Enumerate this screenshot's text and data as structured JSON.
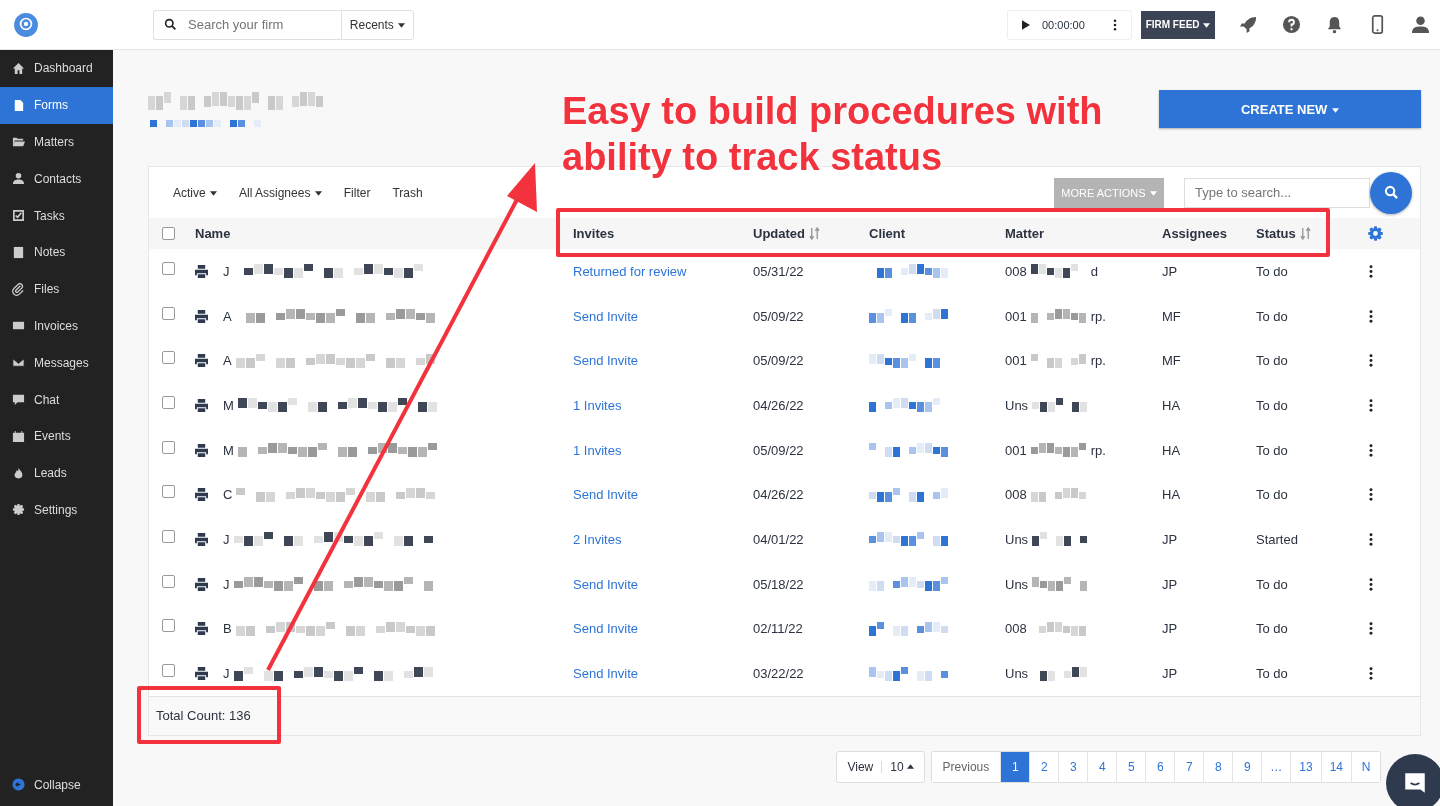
{
  "topbar": {
    "search": {
      "placeholder": "Search your firm"
    },
    "recents": "Recents",
    "timer": "00:00:00",
    "firm_feed": "FIRM FEED"
  },
  "sidebar": {
    "items": [
      {
        "label": "Dashboard",
        "selected": false
      },
      {
        "label": "Forms",
        "selected": true
      },
      {
        "label": "Matters",
        "selected": false
      },
      {
        "label": "Contacts",
        "selected": false
      },
      {
        "label": "Tasks",
        "selected": false
      },
      {
        "label": "Notes",
        "selected": false
      },
      {
        "label": "Files",
        "selected": false
      },
      {
        "label": "Invoices",
        "selected": false
      },
      {
        "label": "Messages",
        "selected": false
      },
      {
        "label": "Chat",
        "selected": false
      },
      {
        "label": "Events",
        "selected": false
      },
      {
        "label": "Leads",
        "selected": false
      },
      {
        "label": "Settings",
        "selected": false
      }
    ],
    "collapse": "Collapse"
  },
  "page": {
    "create_button": "CREATE NEW"
  },
  "toolbar": {
    "filters": [
      "Active",
      "All Assignees"
    ],
    "links": [
      "Filter",
      "Trash"
    ],
    "more_actions": "MORE ACTIONS",
    "search": {
      "placeholder": "Type to search..."
    }
  },
  "table": {
    "select_all": {
      "checked": false
    },
    "columns": [
      {
        "label": "Name",
        "sortable": false
      },
      {
        "label": "Invites",
        "sortable": false
      },
      {
        "label": "Updated",
        "sortable": true
      },
      {
        "label": "Client",
        "sortable": false
      },
      {
        "label": "Matter",
        "sortable": false
      },
      {
        "label": "Assignees",
        "sortable": false
      },
      {
        "label": "Status",
        "sortable": true
      }
    ],
    "rows": [
      {
        "checked": false,
        "name": "J",
        "invites": "Returned for review",
        "updated": "05/31/22",
        "matter_start": "008",
        "matter_end": "d",
        "assignees": "JP",
        "status": "To do"
      },
      {
        "checked": false,
        "name": "A",
        "invites": "Send Invite",
        "updated": "05/09/22",
        "matter_start": "001",
        "matter_end": "rp.",
        "assignees": "MF",
        "status": "To do"
      },
      {
        "checked": false,
        "name": "A",
        "invites": "Send Invite",
        "updated": "05/09/22",
        "matter_start": "001",
        "matter_end": "rp.",
        "assignees": "MF",
        "status": "To do"
      },
      {
        "checked": false,
        "name": "M",
        "invites": "1 Invites",
        "updated": "04/26/22",
        "matter_start": "Uns",
        "matter_end": "",
        "assignees": "HA",
        "status": "To do"
      },
      {
        "checked": false,
        "name": "M",
        "invites": "1 Invites",
        "updated": "05/09/22",
        "matter_start": "001",
        "matter_end": "rp.",
        "assignees": "HA",
        "status": "To do"
      },
      {
        "checked": false,
        "name": "C",
        "invites": "Send Invite",
        "updated": "04/26/22",
        "matter_start": "008",
        "matter_end": "",
        "assignees": "HA",
        "status": "To do"
      },
      {
        "checked": false,
        "name": "J",
        "invites": "2 Invites",
        "updated": "04/01/22",
        "matter_start": "Uns",
        "matter_end": "",
        "assignees": "JP",
        "status": "Started"
      },
      {
        "checked": false,
        "name": "J",
        "invites": "Send Invite",
        "updated": "05/18/22",
        "matter_start": "Uns",
        "matter_end": "",
        "assignees": "JP",
        "status": "To do"
      },
      {
        "checked": false,
        "name": "B",
        "invites": "Send Invite",
        "updated": "02/11/22",
        "matter_start": "008",
        "matter_end": "",
        "assignees": "JP",
        "status": "To do"
      },
      {
        "checked": false,
        "name": "J",
        "invites": "Send Invite",
        "updated": "03/22/22",
        "matter_start": "Uns",
        "matter_end": "",
        "assignees": "JP",
        "status": "To do"
      }
    ],
    "total_count": "Total Count: 136"
  },
  "pagination": {
    "view_label": "View",
    "page_size": "10",
    "previous": "Previous",
    "pages": [
      {
        "label": "1",
        "selected": true
      },
      {
        "label": "2",
        "selected": false
      },
      {
        "label": "3",
        "selected": false
      },
      {
        "label": "4",
        "selected": false
      },
      {
        "label": "5",
        "selected": false
      },
      {
        "label": "6",
        "selected": false
      },
      {
        "label": "7",
        "selected": false
      },
      {
        "label": "8",
        "selected": false
      },
      {
        "label": "9",
        "selected": false
      },
      {
        "label": "…",
        "selected": false
      },
      {
        "label": "13",
        "selected": false
      },
      {
        "label": "14",
        "selected": false
      },
      {
        "label": "N",
        "selected": false
      }
    ]
  },
  "annotation": {
    "lines": [
      "Easy to build procedures with",
      "ability to track status"
    ]
  }
}
